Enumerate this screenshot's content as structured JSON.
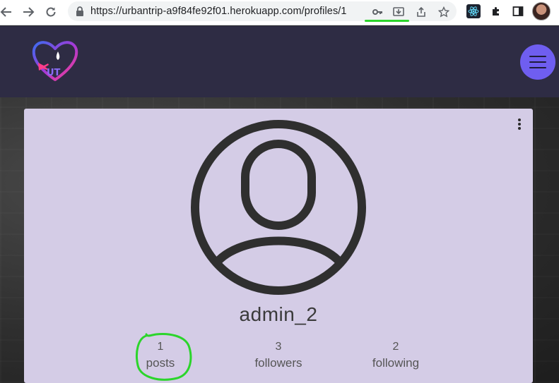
{
  "browser": {
    "url": "https://urbantrip-a9f84fe92f01.herokuapp.com/profiles/1",
    "highlight_color": "#2bd52b"
  },
  "header": {
    "logo_text": "UT",
    "background": "#2e2c44",
    "menu_button_color": "#6f5ef0"
  },
  "profile": {
    "username": "admin_2",
    "card_color": "#d4cce6",
    "stats": [
      {
        "value": "1",
        "label": "posts"
      },
      {
        "value": "3",
        "label": "followers"
      },
      {
        "value": "2",
        "label": "following"
      }
    ]
  }
}
